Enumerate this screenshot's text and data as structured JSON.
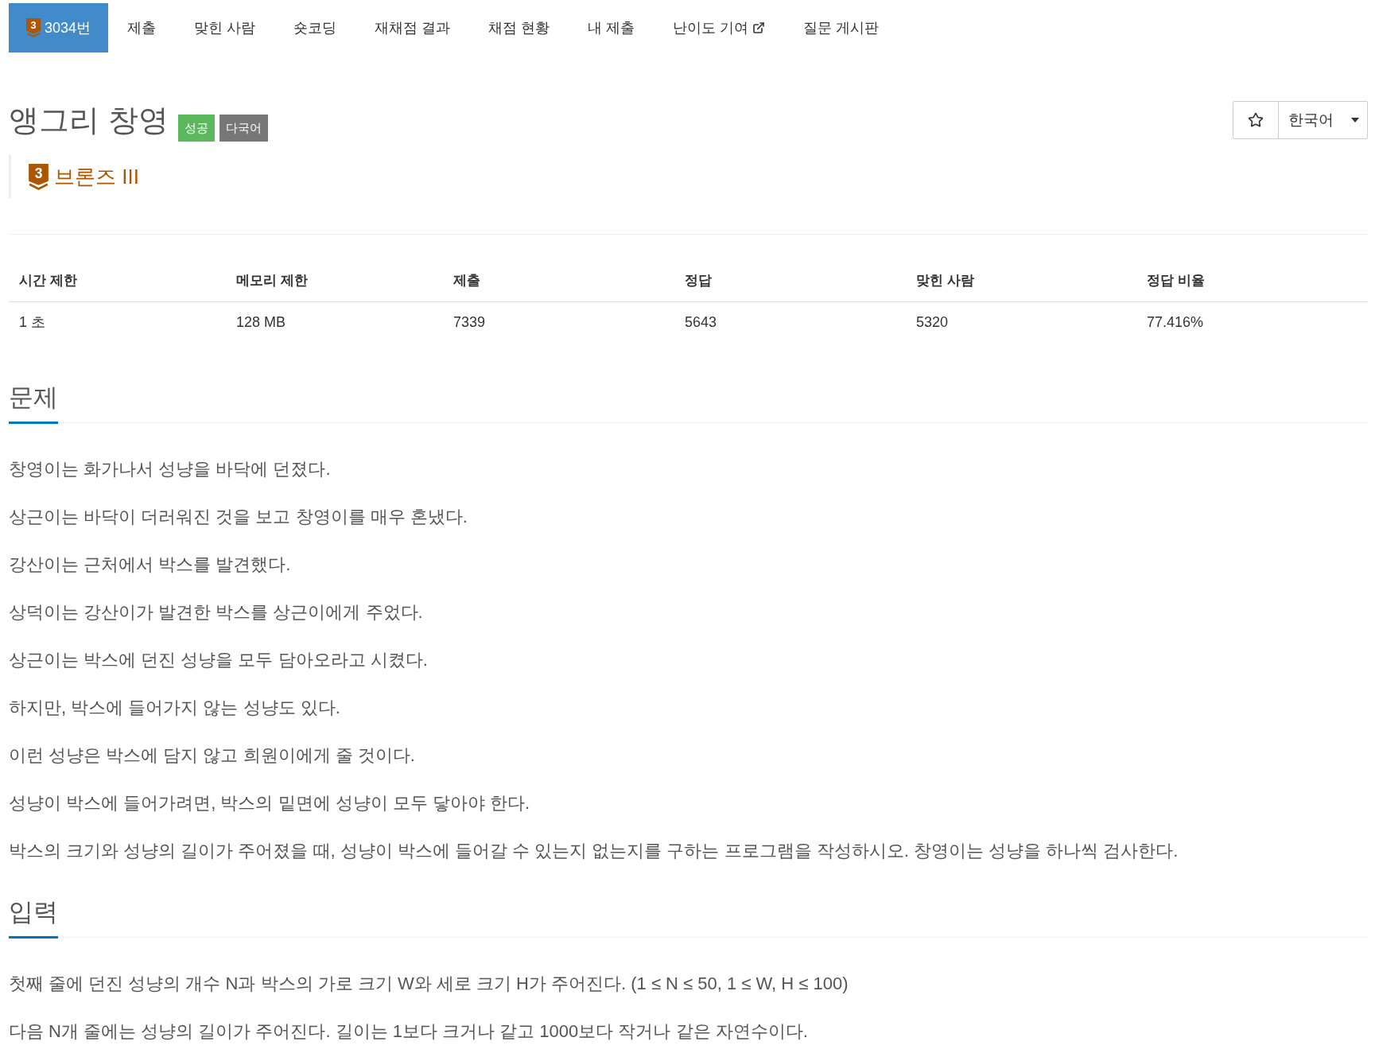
{
  "tabs": [
    {
      "label": "3034번",
      "tier_badge": "3",
      "selected": true,
      "external": false
    },
    {
      "label": "제출",
      "selected": false,
      "external": false
    },
    {
      "label": "맞힌 사람",
      "selected": false,
      "external": false
    },
    {
      "label": "숏코딩",
      "selected": false,
      "external": false
    },
    {
      "label": "재채점 결과",
      "selected": false,
      "external": false
    },
    {
      "label": "채점 현황",
      "selected": false,
      "external": false
    },
    {
      "label": "내 제출",
      "selected": false,
      "external": false
    },
    {
      "label": "난이도 기여",
      "selected": false,
      "external": true
    },
    {
      "label": "질문 게시판",
      "selected": false,
      "external": false
    }
  ],
  "problem": {
    "title": "앵그리 창영",
    "tags": [
      {
        "label": "성공",
        "color": "#5cb85c"
      },
      {
        "label": "다국어",
        "color": "#777777"
      }
    ],
    "tier": {
      "badge": "3",
      "label": "브론즈 III"
    }
  },
  "actions": {
    "starred": false,
    "language": "한국어"
  },
  "stats": {
    "columns": [
      "시간 제한",
      "메모리 제한",
      "제출",
      "정답",
      "맞힌 사람",
      "정답 비율"
    ],
    "rows": [
      [
        "1 초",
        "128 MB",
        "7339",
        "5643",
        "5320",
        "77.416%"
      ]
    ]
  },
  "sections": [
    {
      "title": "문제",
      "paragraphs": [
        "창영이는 화가나서 성냥을 바닥에 던졌다.",
        "상근이는 바닥이 더러워진 것을 보고 창영이를 매우 혼냈다.",
        "강산이는 근처에서 박스를 발견했다.",
        "상덕이는 강산이가 발견한 박스를 상근이에게 주었다.",
        "상근이는 박스에 던진 성냥을 모두 담아오라고 시켰다.",
        "하지만, 박스에 들어가지 않는 성냥도 있다.",
        "이런 성냥은 박스에 담지 않고 희원이에게 줄 것이다.",
        "성냥이 박스에 들어가려면, 박스의 밑면에 성냥이 모두 닿아야 한다.",
        "박스의 크기와 성냥의 길이가 주어졌을 때, 성냥이 박스에 들어갈 수 있는지 없는지를 구하는 프로그램을 작성하시오. 창영이는 성냥을 하나씩 검사한다."
      ]
    },
    {
      "title": "입력",
      "paragraphs": [
        "첫째 줄에 던진 성냥의 개수 N과 박스의 가로 크기 W와 세로 크기 H가 주어진다. (1 ≤ N ≤ 50, 1 ≤ W, H ≤ 100)",
        "다음 N개 줄에는 성냥의 길이가 주어진다. 길이는 1보다 크거나 같고 1000보다 작거나 같은 자연수이다."
      ]
    }
  ]
}
